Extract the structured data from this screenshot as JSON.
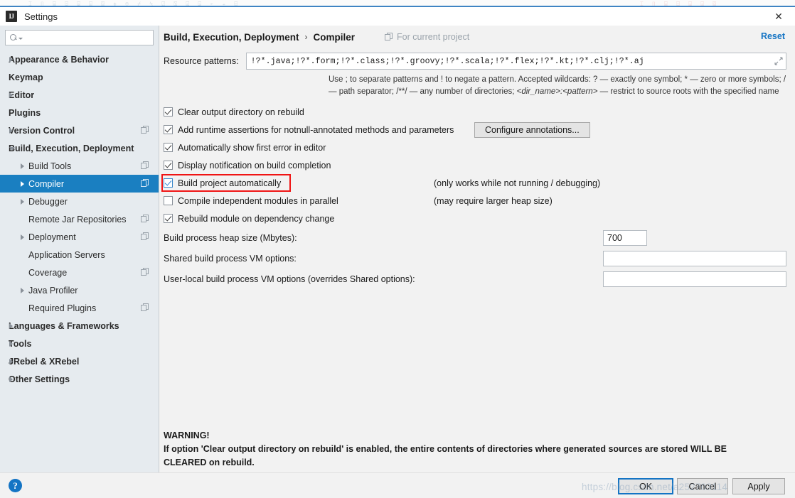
{
  "window": {
    "title": "Settings",
    "app_icon": "IJ",
    "close_icon": "✕"
  },
  "sidebar": {
    "search": {
      "value": "",
      "placeholder": ""
    },
    "items": [
      {
        "label": "Appearance & Behavior",
        "level": 0,
        "arrow": "collapsed",
        "copy": false,
        "selected": false
      },
      {
        "label": "Keymap",
        "level": 0,
        "arrow": "none",
        "copy": false,
        "selected": false
      },
      {
        "label": "Editor",
        "level": 0,
        "arrow": "collapsed",
        "copy": false,
        "selected": false
      },
      {
        "label": "Plugins",
        "level": 0,
        "arrow": "none",
        "copy": false,
        "selected": false
      },
      {
        "label": "Version Control",
        "level": 0,
        "arrow": "collapsed",
        "copy": true,
        "selected": false
      },
      {
        "label": "Build, Execution, Deployment",
        "level": 0,
        "arrow": "expanded",
        "copy": false,
        "selected": false
      },
      {
        "label": "Build Tools",
        "level": 1,
        "arrow": "collapsed",
        "copy": true,
        "selected": false
      },
      {
        "label": "Compiler",
        "level": 1,
        "arrow": "collapsed",
        "copy": true,
        "selected": true
      },
      {
        "label": "Debugger",
        "level": 1,
        "arrow": "collapsed",
        "copy": false,
        "selected": false
      },
      {
        "label": "Remote Jar Repositories",
        "level": 1,
        "arrow": "none",
        "copy": true,
        "selected": false
      },
      {
        "label": "Deployment",
        "level": 1,
        "arrow": "collapsed",
        "copy": true,
        "selected": false
      },
      {
        "label": "Application Servers",
        "level": 1,
        "arrow": "none",
        "copy": false,
        "selected": false
      },
      {
        "label": "Coverage",
        "level": 1,
        "arrow": "none",
        "copy": true,
        "selected": false
      },
      {
        "label": "Java Profiler",
        "level": 1,
        "arrow": "collapsed",
        "copy": false,
        "selected": false
      },
      {
        "label": "Required Plugins",
        "level": 1,
        "arrow": "none",
        "copy": true,
        "selected": false
      },
      {
        "label": "Languages & Frameworks",
        "level": 0,
        "arrow": "collapsed",
        "copy": false,
        "selected": false
      },
      {
        "label": "Tools",
        "level": 0,
        "arrow": "collapsed",
        "copy": false,
        "selected": false
      },
      {
        "label": "JRebel & XRebel",
        "level": 0,
        "arrow": "collapsed",
        "copy": false,
        "selected": false
      },
      {
        "label": "Other Settings",
        "level": 0,
        "arrow": "collapsed",
        "copy": false,
        "selected": false
      }
    ]
  },
  "header": {
    "breadcrumb_root": "Build, Execution, Deployment",
    "breadcrumb_sep": "›",
    "breadcrumb_leaf": "Compiler",
    "scope_label": "For current project",
    "reset_label": "Reset"
  },
  "patterns": {
    "label": "Resource patterns:",
    "value": "!?*.java;!?*.form;!?*.class;!?*.groovy;!?*.scala;!?*.flex;!?*.kt;!?*.clj;!?*.aj",
    "help_line1": "Use ; to separate patterns and ! to negate a pattern. Accepted wildcards: ? — exactly one symbol; * — zero or more symbols; / — path",
    "help_line2_a": "separator; /**/ — any number of directories; ",
    "help_line2_b": "<dir_name>:<pattern>",
    "help_line2_c": " — restrict to source roots with the specified name"
  },
  "checkboxes": [
    {
      "label": "Clear output directory on rebuild",
      "checked": true,
      "note": "",
      "highlighted": false
    },
    {
      "label": "Add runtime assertions for notnull-annotated methods and parameters",
      "checked": true,
      "note": "",
      "highlighted": false
    },
    {
      "label": "Automatically show first error in editor",
      "checked": true,
      "note": "",
      "highlighted": false
    },
    {
      "label": "Display notification on build completion",
      "checked": true,
      "note": "",
      "highlighted": false
    },
    {
      "label": "Build project automatically",
      "checked": true,
      "note": "(only works while not running / debugging)",
      "highlighted": true
    },
    {
      "label": "Compile independent modules in parallel",
      "checked": false,
      "note": "(may require larger heap size)",
      "highlighted": false
    },
    {
      "label": "Rebuild module on dependency change",
      "checked": true,
      "note": "",
      "highlighted": false
    }
  ],
  "configure_annotations_label": "Configure annotations...",
  "fields": [
    {
      "label": "Build process heap size (Mbytes):",
      "value": "700",
      "wide": false
    },
    {
      "label": "Shared build process VM options:",
      "value": "",
      "wide": true
    },
    {
      "label": "User-local build process VM options (overrides Shared options):",
      "value": "",
      "wide": true
    }
  ],
  "warning": {
    "title": "WARNING!",
    "text": "If option 'Clear output directory on rebuild' is enabled, the entire contents of directories where generated sources are stored WILL BE CLEARED on rebuild."
  },
  "footer": {
    "help_label": "?",
    "ok_label": "OK",
    "cancel_label": "Cancel",
    "apply_label": "Apply"
  },
  "watermark": "https://blog.csdn.net/a252703114",
  "colors": {
    "accent": "#1a7fc1",
    "link": "#1474c4",
    "highlight": "#f01414",
    "sidebar_bg": "#e6ebef",
    "panel_bg": "#f2f2f2"
  }
}
